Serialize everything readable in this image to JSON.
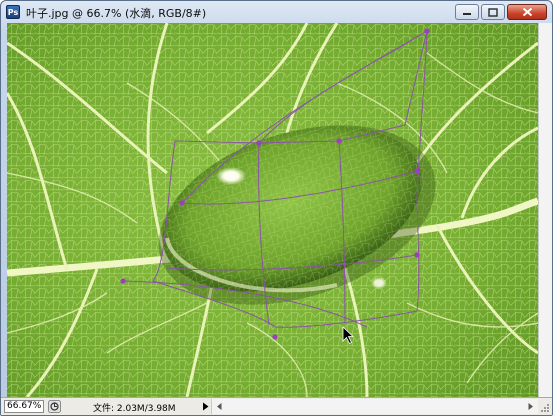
{
  "window": {
    "title": "叶子.jpg @ 66.7% (水滴, RGB/8#)",
    "app_icon": "photoshop-doc-icon",
    "buttons": [
      "minimize-icon",
      "maximize-icon",
      "close-icon"
    ]
  },
  "canvas": {
    "image_subject": "green leaf with water droplet",
    "overlay": "warp transform grid",
    "colors": {
      "leaf": "#7fb23a",
      "veins": "#e8f2b0",
      "droplet_shadow": "#2d4a10",
      "warp_grid": "#8a55a8",
      "warp_point": "#9b3fbf"
    }
  },
  "status": {
    "zoom": "66.67%",
    "doc_info": "文件: 2.03M/3.98M",
    "arrow_icon": "triangle-right-icon"
  }
}
